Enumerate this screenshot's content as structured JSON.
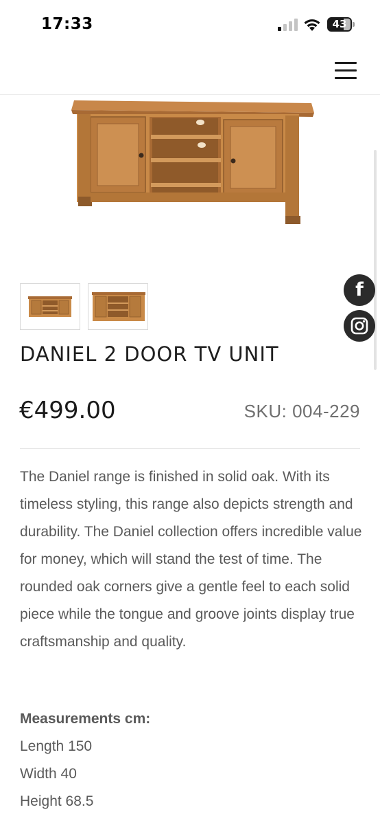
{
  "status_bar": {
    "time": "17:33",
    "battery": "43",
    "icons": [
      "signal-icon",
      "wifi-icon",
      "battery-icon"
    ]
  },
  "header": {
    "menu_icon": "hamburger-menu-icon"
  },
  "product": {
    "title": "DANIEL 2 DOOR TV UNIT",
    "price": "€499.00",
    "sku": "SKU: 004-229",
    "description": "The Daniel range is finished in solid oak. With its timeless styling, this range also depicts strength and durability. The Daniel collection offers incredible value for money, which will stand the test of time. The rounded oak corners give a gentle feel to each solid piece while the tongue and groove joints display true craftsmanship and quality.",
    "measurements_heading": "Measurements cm:",
    "measurements": [
      "Length 150",
      "Width 40",
      "Height 68.5"
    ]
  },
  "social": {
    "facebook_icon": "facebook-icon",
    "instagram_icon": "instagram-icon",
    "facebook_glyph": "f"
  },
  "colors": {
    "wood": "#c98a48",
    "social_bg": "#2b2b2b",
    "text": "#5a5a5a"
  }
}
